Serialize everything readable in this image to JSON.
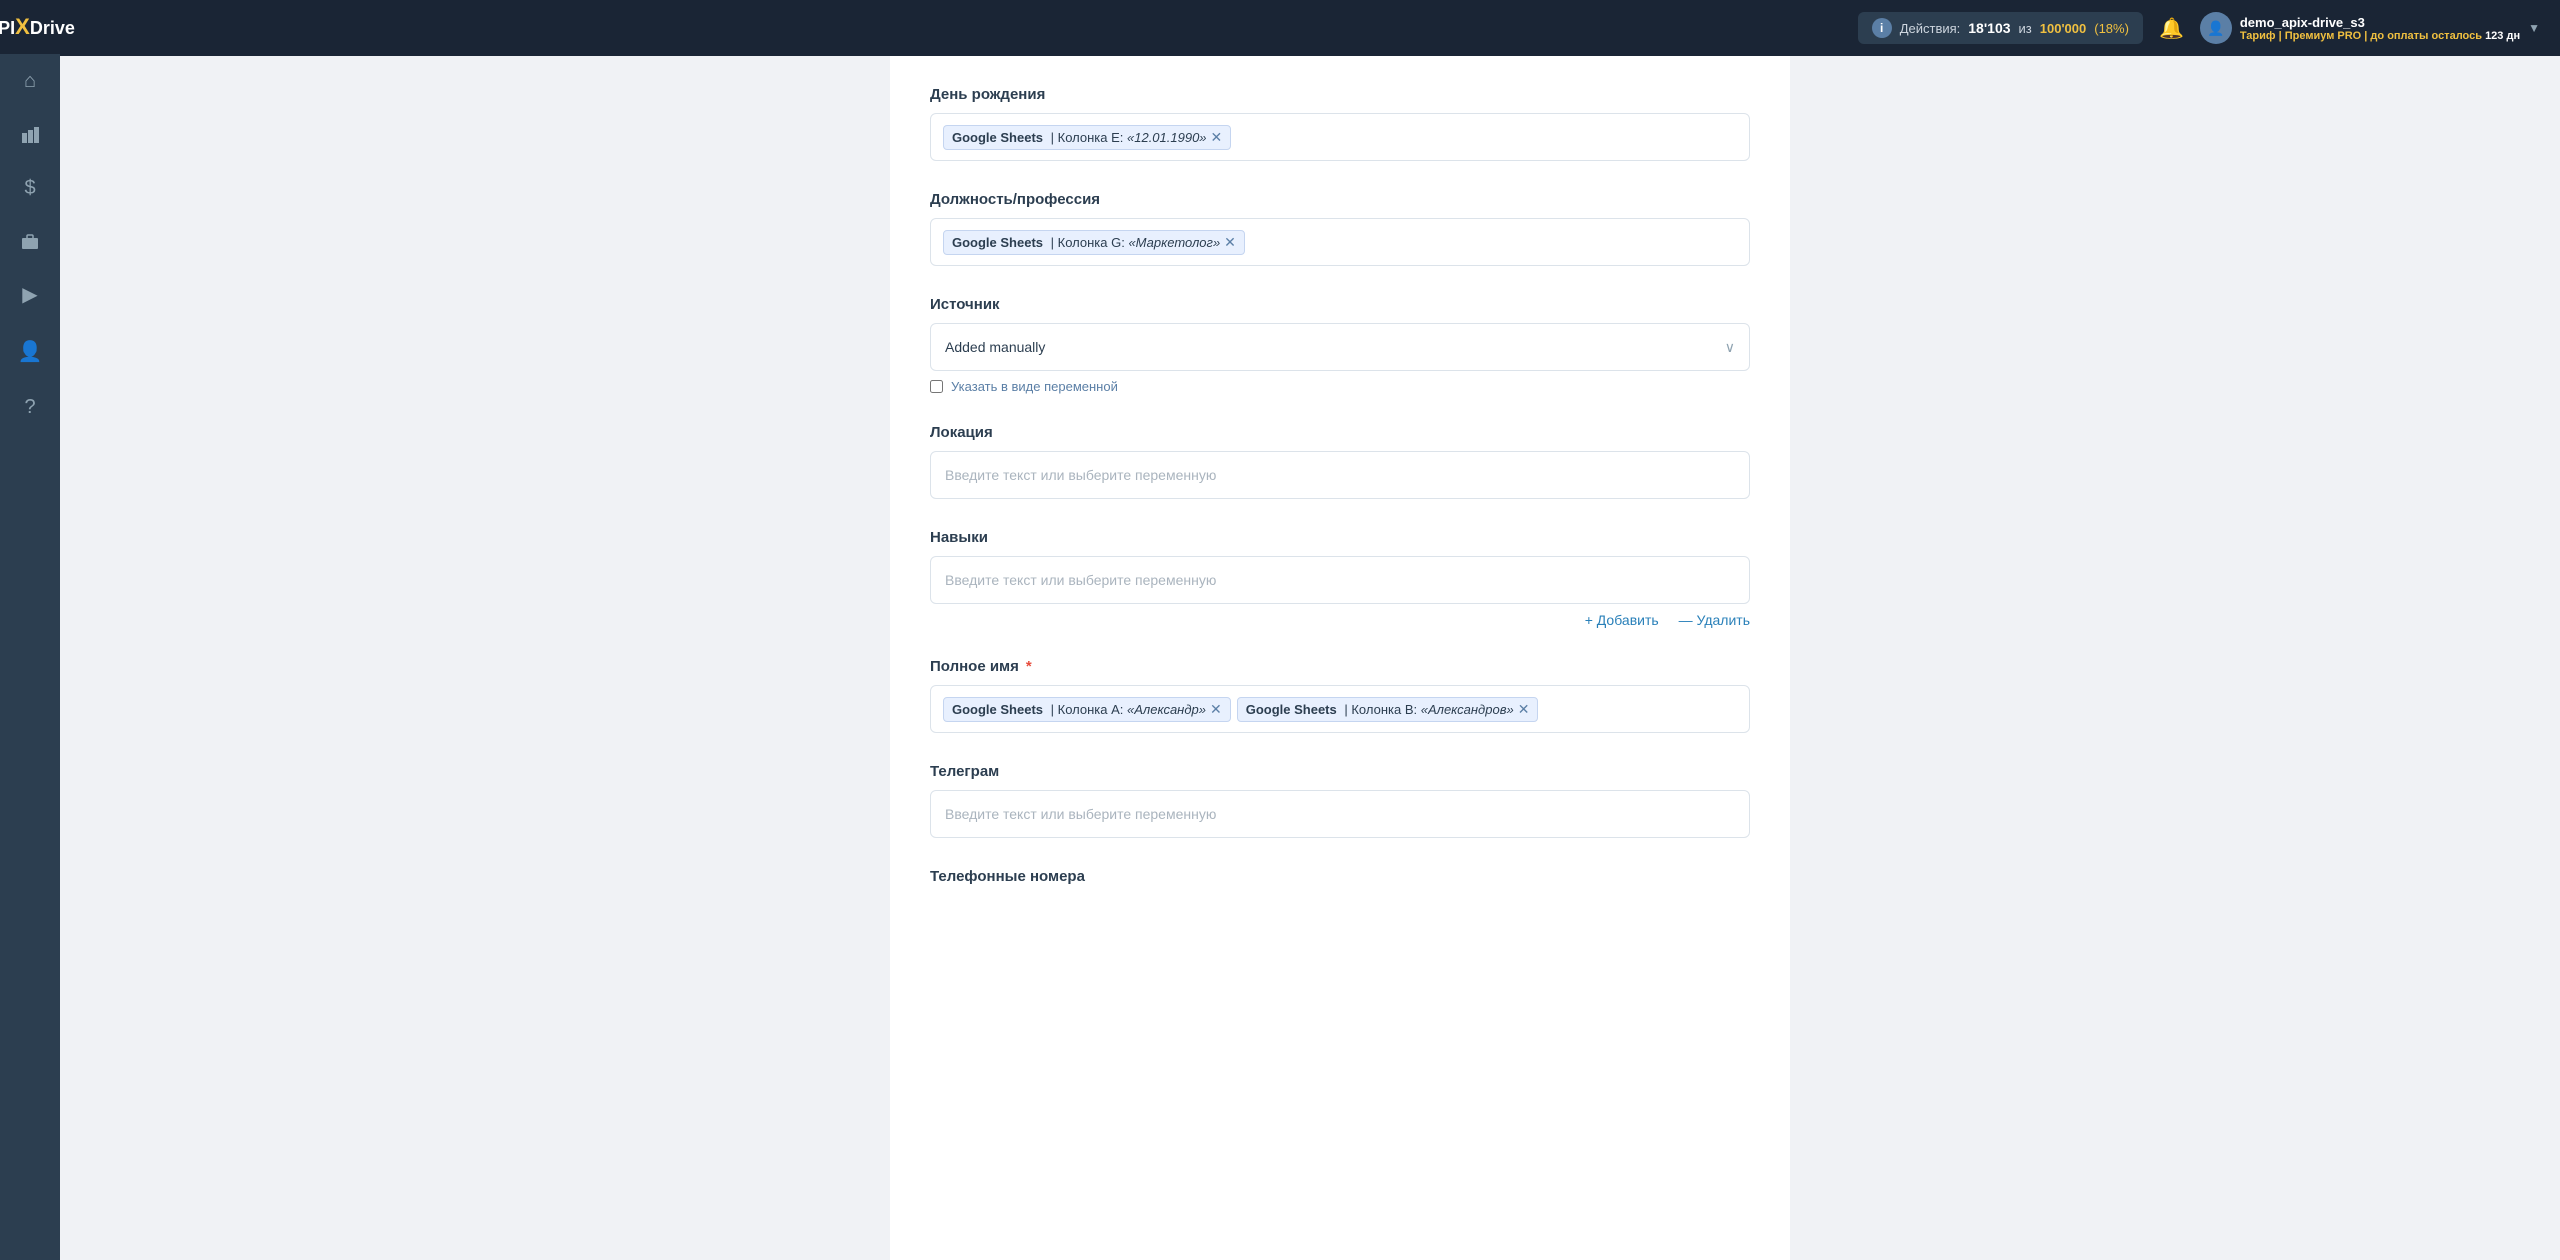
{
  "sidebar": {
    "items": [
      {
        "name": "home",
        "icon": "⌂"
      },
      {
        "name": "diagram",
        "icon": "⬛"
      },
      {
        "name": "billing",
        "icon": "$"
      },
      {
        "name": "briefcase",
        "icon": "💼"
      },
      {
        "name": "youtube",
        "icon": "▶"
      },
      {
        "name": "user",
        "icon": "👤"
      },
      {
        "name": "help",
        "icon": "?"
      }
    ]
  },
  "topbar": {
    "actions_label": "Действия:",
    "count": "18'103",
    "separator": "из",
    "total": "100'000",
    "percent": "(18%)",
    "username": "demo_apix-drive_s3",
    "plan_label": "Тариф |",
    "plan_name": "Премиум PRO",
    "plan_suffix": "| до оплаты осталось",
    "days": "123 дн"
  },
  "fields": {
    "birthday": {
      "label": "День рождения",
      "tags": [
        {
          "source": "Google Sheets",
          "column": "Колонка E:",
          "value": "«12.01.1990»"
        }
      ]
    },
    "profession": {
      "label": "Должность/профессия",
      "tags": [
        {
          "source": "Google Sheets",
          "column": "Колонка G:",
          "value": "«Маркетолог»"
        }
      ]
    },
    "source": {
      "label": "Источник",
      "value": "Added manually",
      "checkbox_label": "Указать в виде переменной"
    },
    "location": {
      "label": "Локация",
      "placeholder": "Введите текст или выберите переменную"
    },
    "skills": {
      "label": "Навыки",
      "placeholder": "Введите текст или выберите переменную",
      "add_label": "+ Добавить",
      "remove_label": "— Удалить"
    },
    "fullname": {
      "label": "Полное имя",
      "required": true,
      "tags": [
        {
          "source": "Google Sheets",
          "column": "Колонка А:",
          "value": "«Александр»"
        },
        {
          "source": "Google Sheets",
          "column": "Колонка B:",
          "value": "«Александров»"
        }
      ]
    },
    "telegram": {
      "label": "Телеграм",
      "placeholder": "Введите текст или выберите переменную"
    },
    "phones": {
      "label": "Телефонные номера"
    }
  }
}
